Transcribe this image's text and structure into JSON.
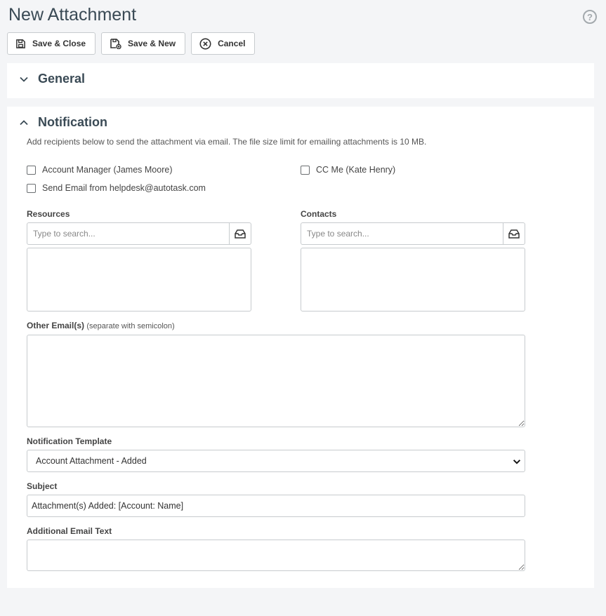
{
  "page": {
    "title": "New Attachment",
    "help_icon": "question-circle-icon"
  },
  "toolbar": {
    "save_close_label": "Save & Close",
    "save_new_label": "Save & New",
    "cancel_label": "Cancel"
  },
  "general": {
    "title": "General",
    "expanded": false
  },
  "notification": {
    "title": "Notification",
    "expanded": true,
    "description": "Add recipients below to send the attachment via email. The file size limit for emailing attachments is 10 MB.",
    "checkboxes": {
      "account_manager": {
        "label": "Account Manager (James Moore)",
        "checked": false
      },
      "cc_me": {
        "label": "CC Me (Kate Henry)",
        "checked": false
      },
      "send_email_from": {
        "label": "Send Email from helpdesk@autotask.com",
        "checked": false
      }
    },
    "resources": {
      "label": "Resources",
      "placeholder": "Type to search..."
    },
    "contacts": {
      "label": "Contacts",
      "placeholder": "Type to search..."
    },
    "other_emails": {
      "label": "Other Email(s)",
      "hint": "(separate with semicolon)",
      "value": ""
    },
    "template": {
      "label": "Notification Template",
      "value": "Account Attachment - Added"
    },
    "subject": {
      "label": "Subject",
      "value": "Attachment(s) Added: [Account: Name]"
    },
    "additional_text": {
      "label": "Additional Email Text",
      "value": ""
    }
  },
  "colors": {
    "background": "#f4f5f7",
    "panel": "#ffffff",
    "heading": "#3a4a55",
    "border": "#c7cbce"
  }
}
